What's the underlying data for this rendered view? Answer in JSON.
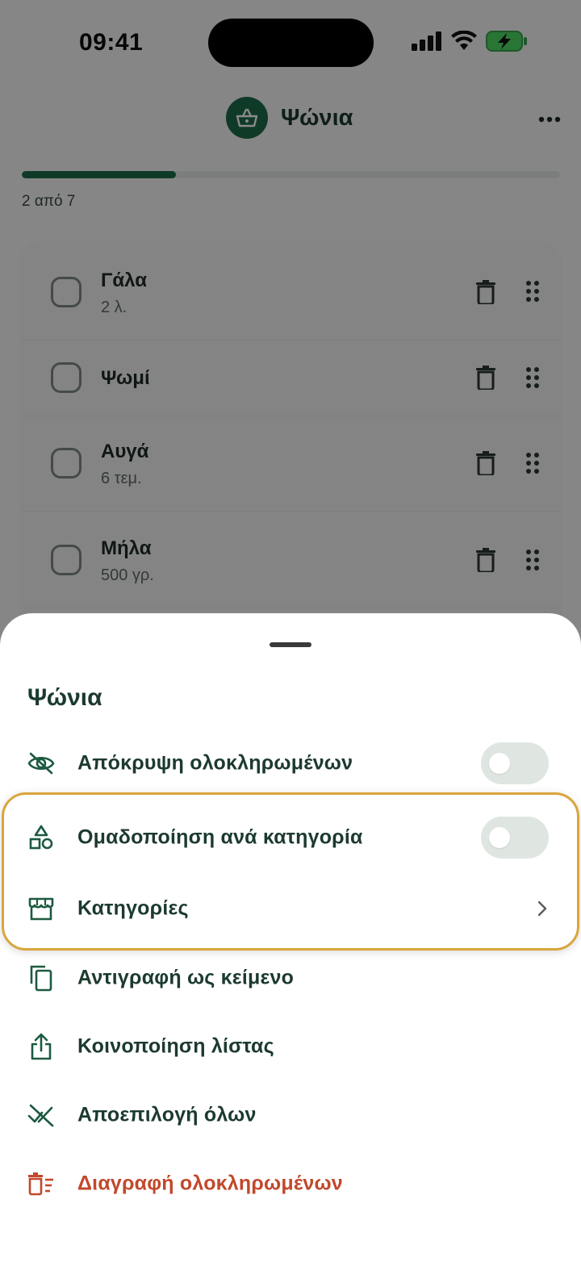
{
  "status_bar": {
    "time": "09:41"
  },
  "header": {
    "title": "Ψώνια",
    "basket_icon": "basket-icon",
    "more_icon": "more-horizontal-icon"
  },
  "progress": {
    "text": "2 από 7",
    "done": 2,
    "total": 7,
    "accent": "#1e6b4a"
  },
  "list": {
    "items": [
      {
        "name": "Γάλα",
        "qty": "2 λ."
      },
      {
        "name": "Ψωμί",
        "qty": ""
      },
      {
        "name": "Αυγά",
        "qty": "6 τεμ."
      },
      {
        "name": "Μήλα",
        "qty": "500 γρ."
      }
    ]
  },
  "sheet": {
    "title": "Ψώνια",
    "rows": [
      {
        "label": "Απόκρυψη ολοκληρωμένων",
        "icon": "eye-off-icon",
        "control": "toggle",
        "on": false
      },
      {
        "label": "Ομαδοποίηση ανά κατηγορία",
        "icon": "shapes-icon",
        "control": "toggle",
        "on": false
      },
      {
        "label": "Κατηγορίες",
        "icon": "store-icon",
        "control": "chevron"
      },
      {
        "label": "Αντιγραφή ως κείμενο",
        "icon": "copy-icon"
      },
      {
        "label": "Κοινοποίηση λίστας",
        "icon": "share-icon"
      },
      {
        "label": "Αποεπιλογή όλων",
        "icon": "uncheck-all-icon"
      },
      {
        "label": "Διαγραφή ολοκληρωμένων",
        "icon": "delete-list-icon",
        "danger": true
      }
    ]
  },
  "colors": {
    "primary": "#1c3a2e",
    "danger": "#c2482b",
    "highlight": "#d9a53c"
  }
}
